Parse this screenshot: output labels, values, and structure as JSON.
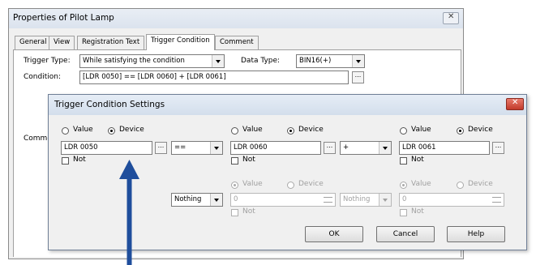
{
  "outer": {
    "title": "Properties of Pilot Lamp",
    "tabs": [
      "General",
      "View",
      "Registration Text",
      "Trigger Condition",
      "Comment"
    ],
    "active_tab": "Trigger Condition",
    "trigger_type_label": "Trigger Type:",
    "trigger_type_value": "While satisfying the condition",
    "data_type_label": "Data Type:",
    "data_type_value": "BIN16(+)",
    "condition_label": "Condition:",
    "condition_value": "[LDR 0050] == [LDR 0060] + [LDR 0061]",
    "comment_label_partial": "Comme",
    "ellipsis": "..."
  },
  "dialog": {
    "title": "Trigger Condition Settings",
    "value_label": "Value",
    "device_label": "Device",
    "not_label": "Not",
    "row1": {
      "col1_device": "LDR 0050",
      "operator1": "==",
      "col2_device": "LDR 0060",
      "operator2": "+",
      "col3_device": "LDR 0061"
    },
    "row2": {
      "operator1": "Nothing",
      "col2_value": "0",
      "operator2": "Nothing",
      "col3_value": "0"
    },
    "buttons": {
      "ok": "OK",
      "cancel": "Cancel",
      "help": "Help"
    }
  },
  "colors": {
    "arrow": "#1f4e9c",
    "dialog_title_bg": "#dbe6f4",
    "close_button": "#c7382b"
  }
}
